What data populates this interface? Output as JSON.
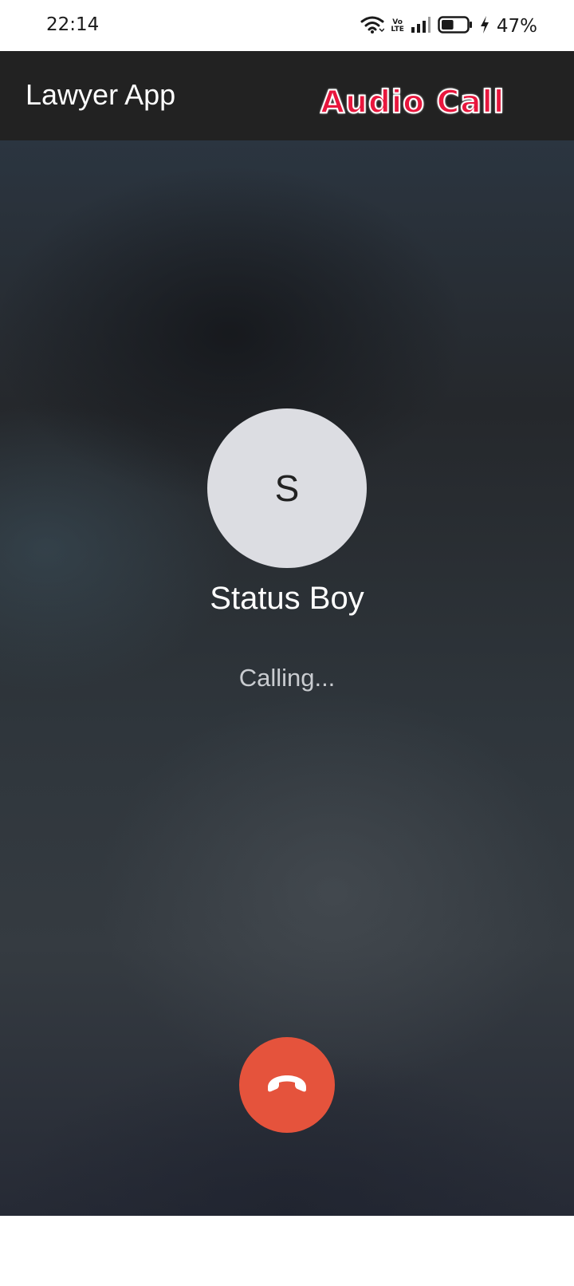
{
  "status_bar": {
    "time": "22:14",
    "volte_top": "Vo",
    "volte_bottom": "LTE",
    "battery_percent": "47%",
    "battery_level": 0.47,
    "icons": [
      "wifi-icon",
      "volte-icon",
      "signal-icon",
      "battery-icon",
      "charging-icon"
    ]
  },
  "app_bar": {
    "title": "Lawyer App",
    "label": "Audio Call"
  },
  "call": {
    "avatar_initial": "S",
    "caller_name": "Status Boy",
    "status": "Calling...",
    "end_call_icon": "phone-hangup-icon"
  },
  "colors": {
    "app_bar_bg": "#222222",
    "label_red": "#e8163d",
    "avatar_bg": "#dcdde2",
    "end_call": "#e5533c"
  }
}
